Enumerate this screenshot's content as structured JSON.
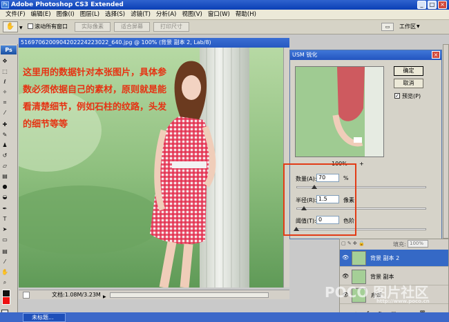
{
  "app": {
    "title": "Adobe Photoshop CS3 Extended",
    "logo": "Ps"
  },
  "menu": [
    "文件(F)",
    "编辑(E)",
    "图像(I)",
    "图层(L)",
    "选择(S)",
    "滤镜(T)",
    "分析(A)",
    "视图(V)",
    "窗口(W)",
    "帮助(H)"
  ],
  "options": {
    "scroll_all": "滚动所有窗口",
    "actual_pixels": "实际像素",
    "fit_screen": "适合屏幕",
    "print_size": "打印尺寸",
    "workspace": "工作区"
  },
  "document": {
    "title": "5169706200904202224223022_640.jpg @ 100% (背景 副本 2, Lab/8)",
    "status": "文档:1.08M/3.23M"
  },
  "note_lines": [
    "这里用的数据针对本张图片，具体参",
    "数必须依据自己的素材，原则就是能",
    "看清楚细节，例如石柱的纹路，头发",
    "的细节等等"
  ],
  "dialog": {
    "title": "USM 锐化",
    "ok": "确定",
    "cancel": "取消",
    "preview": "预览(P)",
    "zoom": "100%",
    "amount_label": "数量(A):",
    "amount_value": "70",
    "amount_unit": "%",
    "amount_level": 0.14,
    "radius_label": "半径(R):",
    "radius_value": "1.5",
    "radius_unit": "像素",
    "radius_level": 0.06,
    "threshold_label": "阈值(T):",
    "threshold_value": "0",
    "threshold_unit": "色阶",
    "threshold_level": 0.0
  },
  "layers": {
    "fill_label": "填充:",
    "fill_value": "100%",
    "items": [
      {
        "name": "背景 副本 2",
        "selected": true
      },
      {
        "name": "背景 副本",
        "selected": false
      },
      {
        "name": "背景",
        "selected": false
      }
    ]
  },
  "taskbar": {
    "item": "未标题..."
  },
  "watermark": {
    "main": "POCO 图片社区",
    "url": "http://www.poco.cn"
  }
}
